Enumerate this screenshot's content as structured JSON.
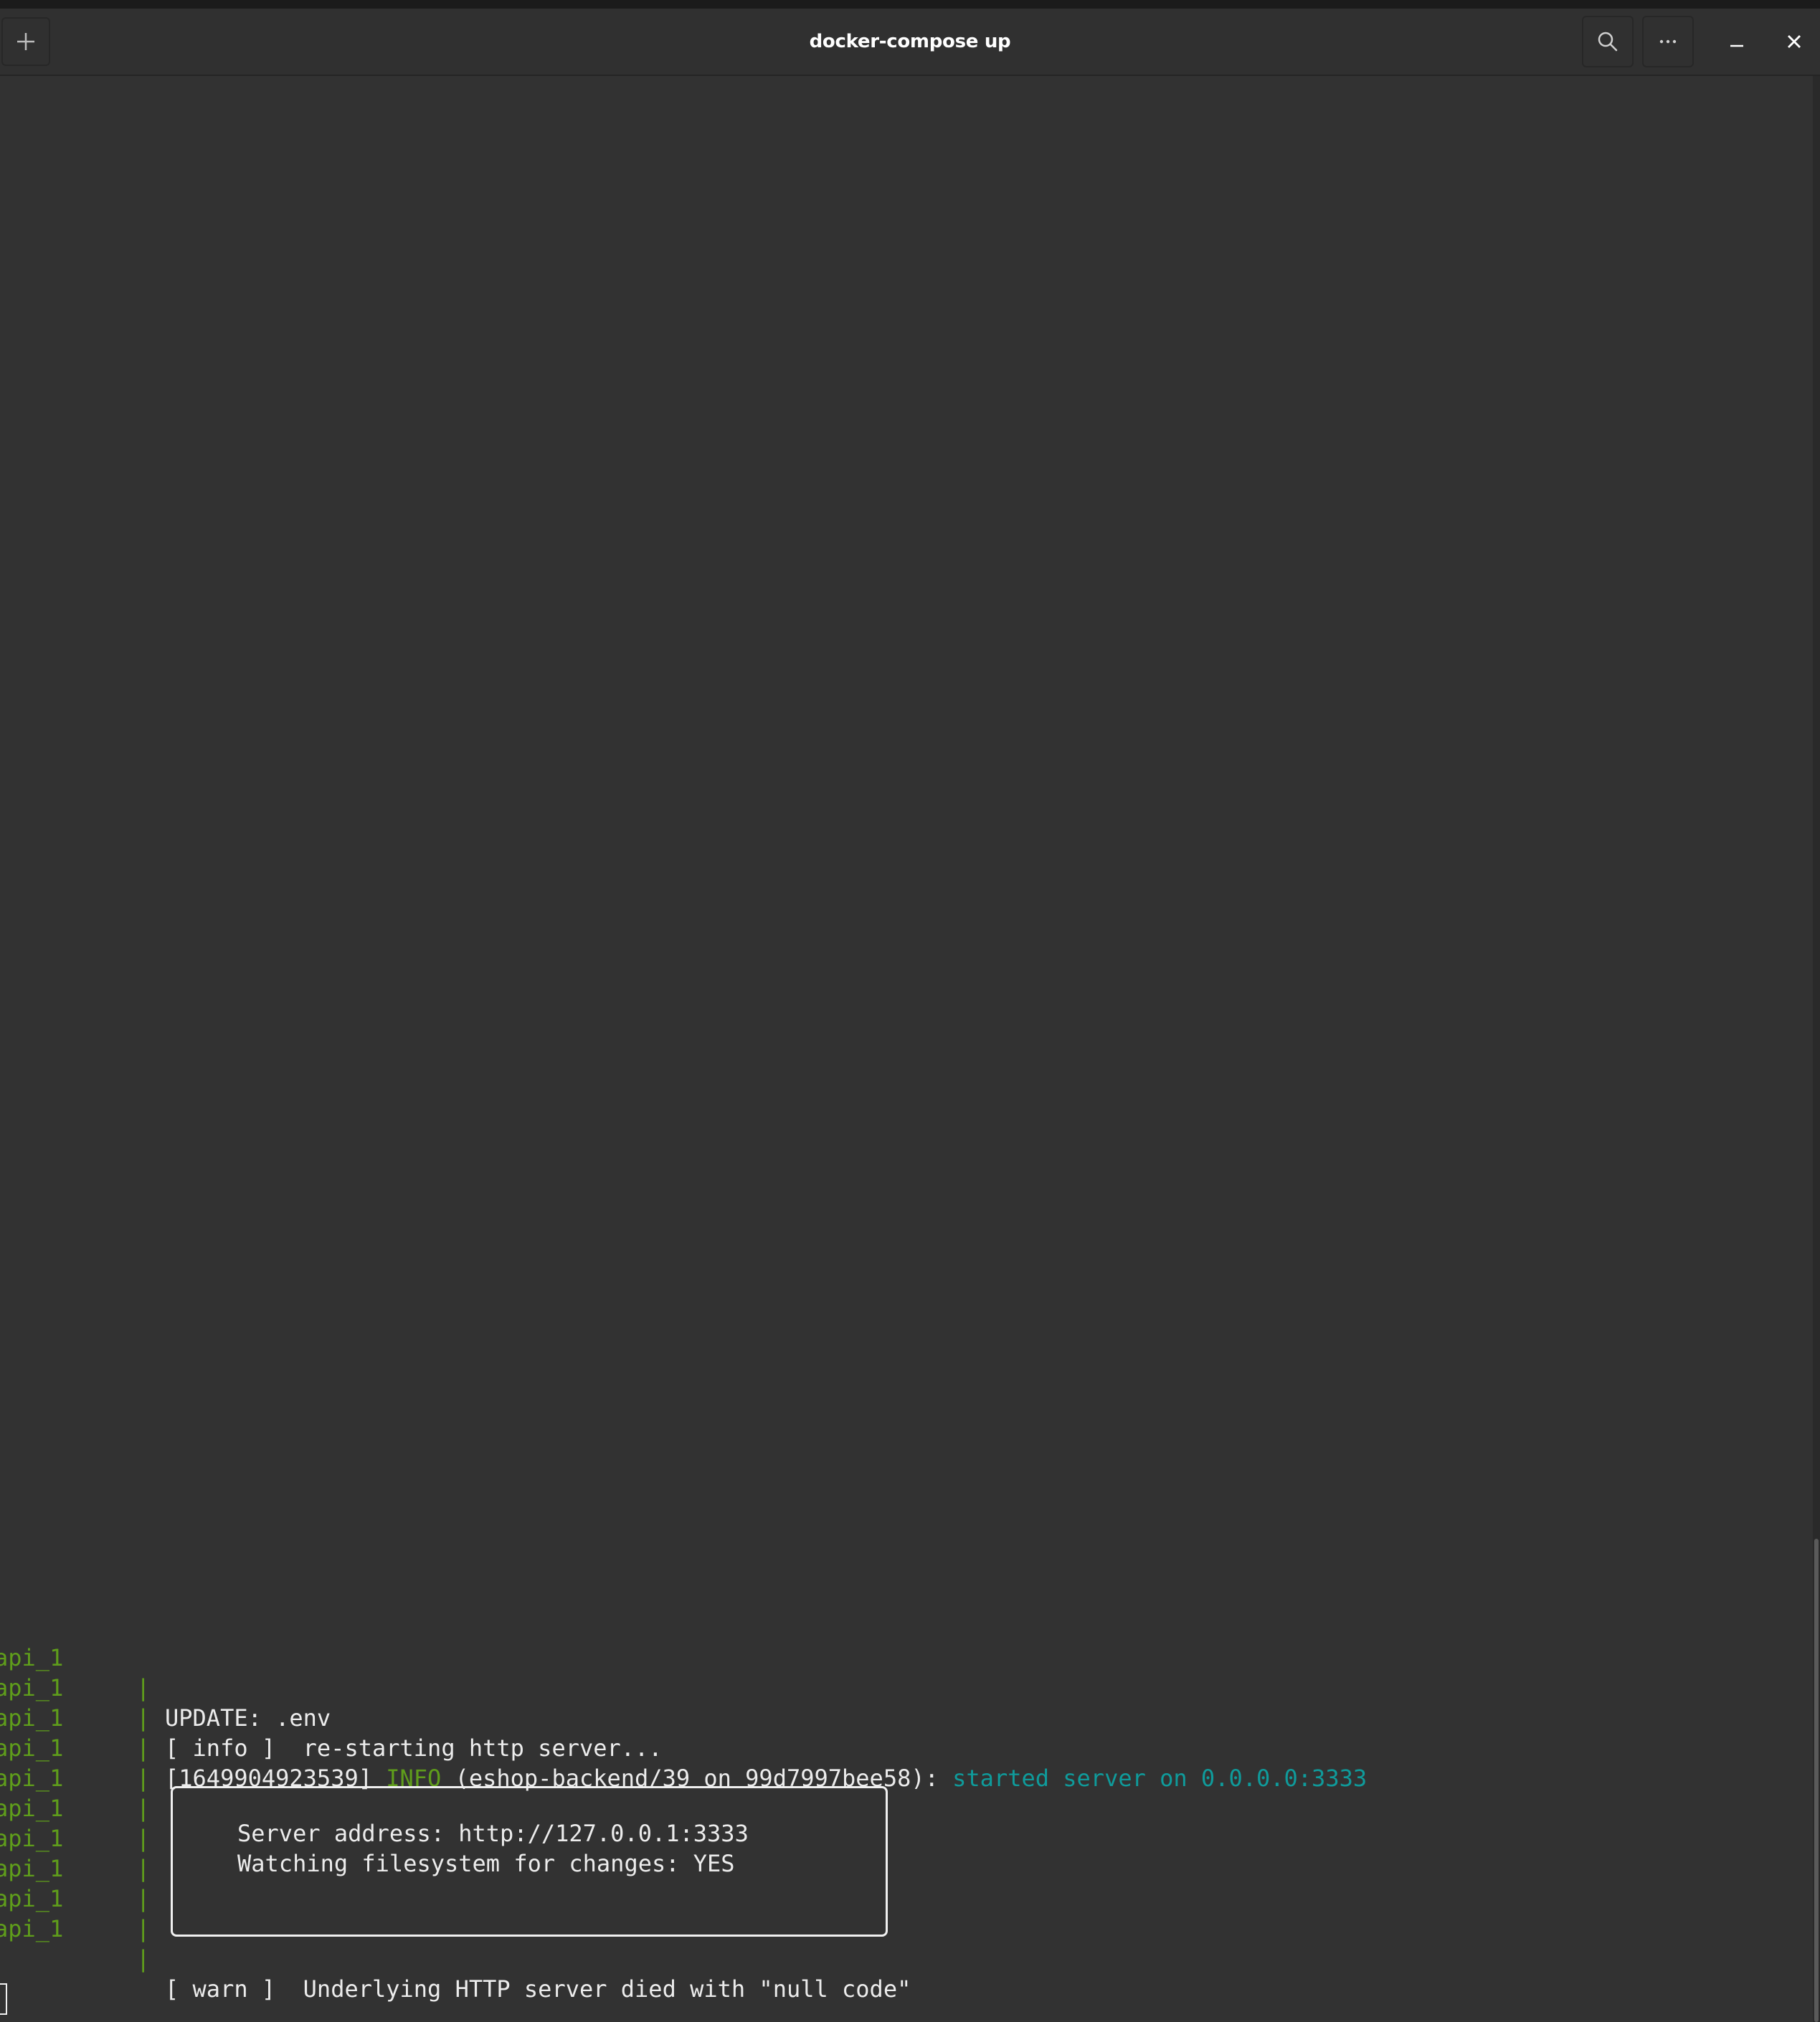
{
  "window": {
    "title": "docker-compose up"
  },
  "titlebar": {
    "new_tab_icon": "plus-icon",
    "search_icon": "search-icon",
    "menu_icon": "ellipsis-icon",
    "minimize_icon": "minimize-icon",
    "close_icon": "close-icon"
  },
  "colors": {
    "service_name": "#5f9d1b",
    "info_level": "#5f9d1b",
    "server_started": "#0f9b9b",
    "terminal_bg": "#323232"
  },
  "terminal": {
    "lines": [
      {
        "service": "api_1",
        "pipe": "|",
        "text": "UPDATE: .env"
      },
      {
        "service": "api_1",
        "pipe": "|",
        "text": "[ info ]  re-starting http server..."
      },
      {
        "service": "api_1",
        "pipe": "|",
        "prefix": "[1649904923539] ",
        "level": "INFO",
        "middle": " (eshop-backend/39 on 99d7997bee58): ",
        "highlight": "started server on 0.0.0.0:3333"
      },
      {
        "service": "api_1",
        "pipe": "|",
        "text": ""
      },
      {
        "service": "api_1",
        "pipe": "|",
        "text": ""
      },
      {
        "service": "api_1",
        "pipe": "|",
        "text": ""
      },
      {
        "service": "api_1",
        "pipe": "|",
        "text": ""
      },
      {
        "service": "api_1",
        "pipe": "|",
        "text": ""
      },
      {
        "service": "api_1",
        "pipe": "|",
        "text": ""
      },
      {
        "service": "api_1",
        "pipe": "|",
        "text": "[ warn ]  Underlying HTTP server died with \"null code\""
      }
    ],
    "box": {
      "line1": "Server address: http://127.0.0.1:3333",
      "line2": "Watching filesystem for changes: YES"
    }
  }
}
